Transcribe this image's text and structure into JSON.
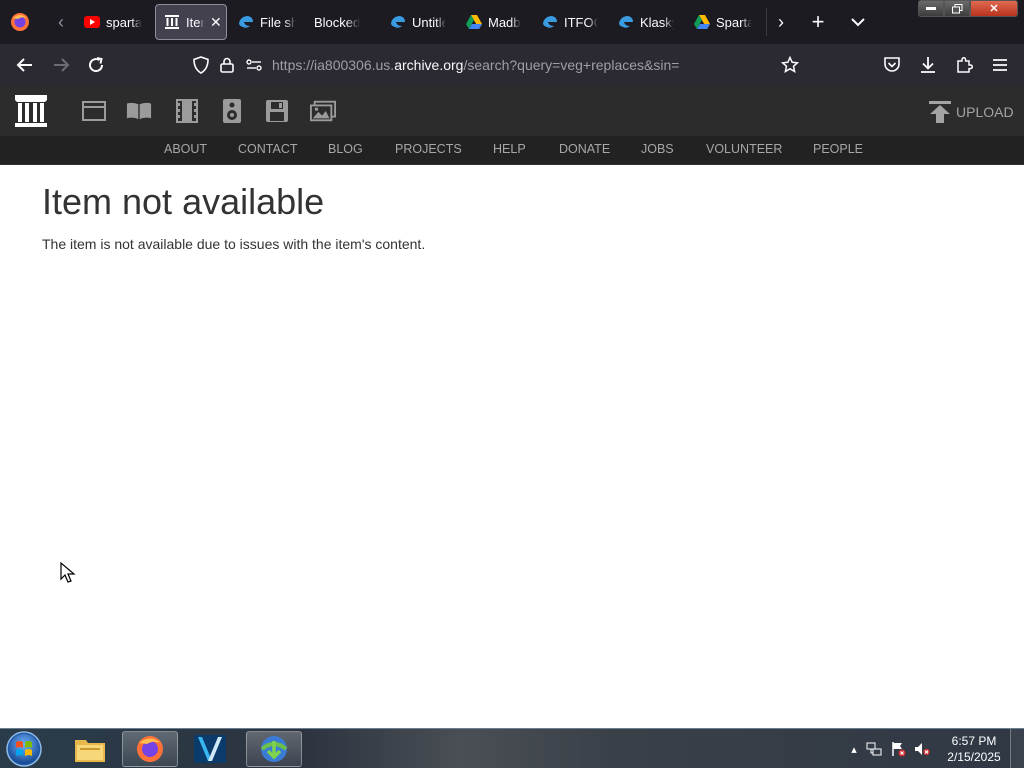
{
  "browser": {
    "tabs": [
      {
        "title": "sparta",
        "icon": "youtube-icon"
      },
      {
        "title": "Item not available",
        "icon": "archive-icon",
        "active": true
      },
      {
        "title": "File sharing",
        "icon": "edge-icon"
      },
      {
        "title": "Blocked",
        "icon": "none"
      },
      {
        "title": "Untitled",
        "icon": "edge-icon"
      },
      {
        "title": "Madb",
        "icon": "drive-icon"
      },
      {
        "title": "ITFOC",
        "icon": "edge-icon"
      },
      {
        "title": "Klasky",
        "icon": "edge-icon"
      },
      {
        "title": "Sparta",
        "icon": "drive-icon"
      }
    ],
    "url_prefix": "https://ia800306.us.",
    "url_domain": "archive.org",
    "url_path": "/search?query=veg+replaces&sin="
  },
  "archive": {
    "upload_label": "UPLOAD",
    "nav": [
      "ABOUT",
      "CONTACT",
      "BLOG",
      "PROJECTS",
      "HELP",
      "DONATE",
      "JOBS",
      "VOLUNTEER",
      "PEOPLE"
    ]
  },
  "content": {
    "title": "Item not available",
    "message": "The item is not available due to issues with the item's content."
  },
  "taskbar": {
    "time": "6:57 PM",
    "date": "2/15/2025"
  },
  "colors": {
    "tabstrip": "#1c1b22",
    "navbar": "#2b2a33",
    "archive_header": "#2c2c2c",
    "archive_nav": "#222222",
    "text": "#333333"
  }
}
